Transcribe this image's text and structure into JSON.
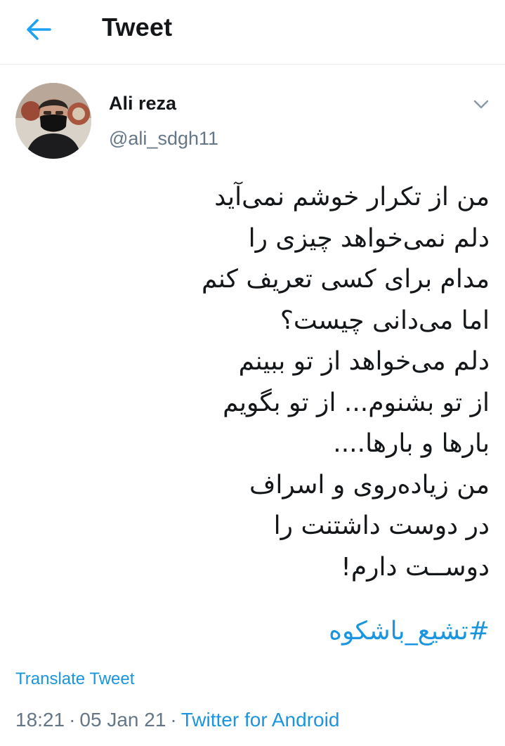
{
  "header": {
    "title": "Tweet",
    "back_icon": "arrow-left-icon",
    "accent_color": "#1da1f2"
  },
  "author": {
    "name": "Ali reza",
    "handle": "@ali_sdgh11",
    "avatar_icon": "avatar-photo"
  },
  "tweet": {
    "lines": [
      "من از تکرار خوشم نمی‌آید",
      "دلم نمی‌خواهد چیزی را",
      "مدام برای کسی تعریف کنم",
      "اما می‌دانی چیست؟",
      "دلم می‌خواهد از تو ببینم",
      "از تو بشنوم... از تو بگویم",
      "بارها و بارها....",
      "من زیاده‌روی و اسراف",
      "در دوست داشتنت را",
      "دوســت دارم!"
    ],
    "hashtag": "#تشیع_باشکوه",
    "translate_label": "Translate Tweet",
    "time": "18:21",
    "date": "05 Jan 21",
    "source": "Twitter for Android",
    "separator": "·"
  },
  "colors": {
    "link": "#1b95e0",
    "secondary_text": "#657786",
    "primary_text": "#14171a",
    "divider": "#e6ecf0"
  },
  "icons": {
    "back": "arrow-left-icon",
    "more": "chevron-down-icon"
  }
}
